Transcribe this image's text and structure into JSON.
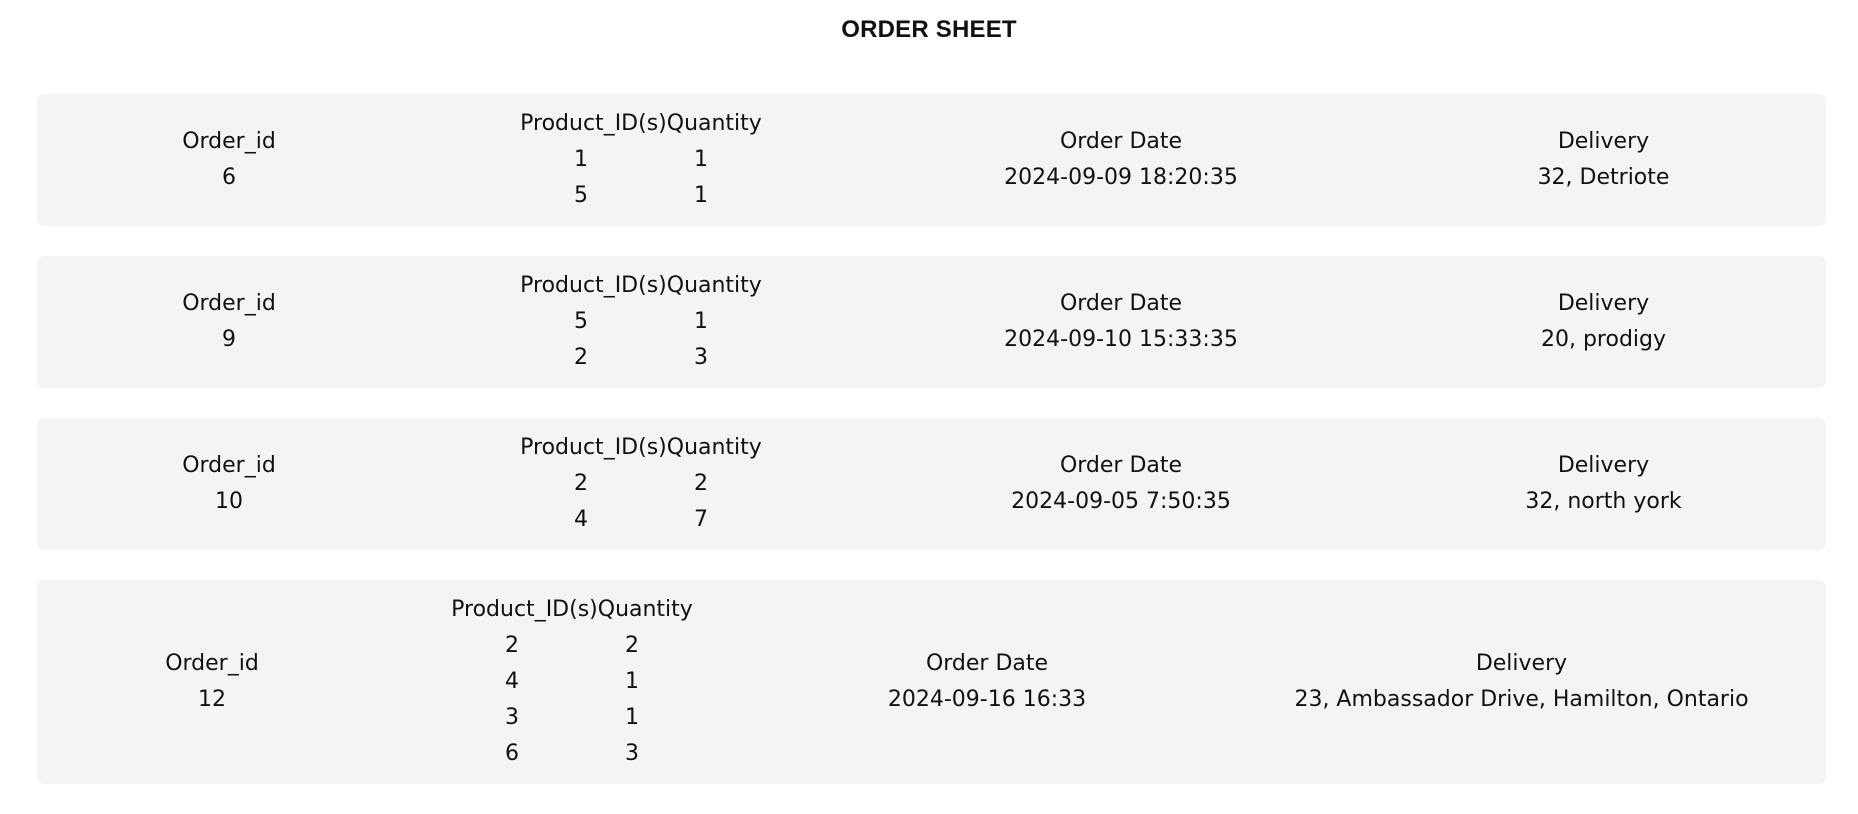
{
  "page": {
    "title": "ORDER SHEET"
  },
  "labels": {
    "order_id": "Order_id",
    "product_ids": "Product_ID(s)",
    "quantity": "Quantity",
    "order_date": "Order Date",
    "delivery": "Delivery"
  },
  "orders": [
    {
      "order_id": "6",
      "items": [
        {
          "product_id": "1",
          "quantity": "1"
        },
        {
          "product_id": "5",
          "quantity": "1"
        }
      ],
      "order_date": "2024-09-09 18:20:35",
      "delivery": "32, Detriote"
    },
    {
      "order_id": "9",
      "items": [
        {
          "product_id": "5",
          "quantity": "1"
        },
        {
          "product_id": "2",
          "quantity": "3"
        }
      ],
      "order_date": "2024-09-10 15:33:35",
      "delivery": "20, prodigy"
    },
    {
      "order_id": "10",
      "items": [
        {
          "product_id": "2",
          "quantity": "2"
        },
        {
          "product_id": "4",
          "quantity": "7"
        }
      ],
      "order_date": "2024-09-05 7:50:35",
      "delivery": "32, north york"
    },
    {
      "order_id": "12",
      "items": [
        {
          "product_id": "2",
          "quantity": "2"
        },
        {
          "product_id": "4",
          "quantity": "1"
        },
        {
          "product_id": "3",
          "quantity": "1"
        },
        {
          "product_id": "6",
          "quantity": "3"
        }
      ],
      "order_date": "2024-09-16 16:33",
      "delivery": "23, Ambassador Drive, Hamilton, Ontario"
    }
  ]
}
